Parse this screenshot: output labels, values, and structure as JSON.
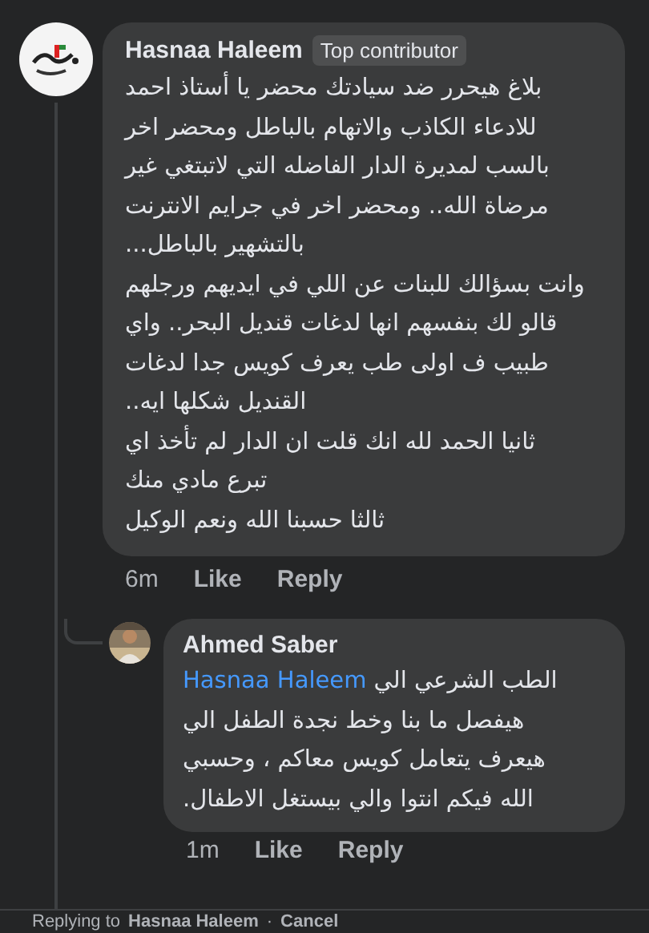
{
  "comment": {
    "author": "Hasnaa Haleem",
    "badge": "Top contributor",
    "text": "بلاغ هيحرر ضد سيادتك محضر يا أستاذ احمد\nللادعاء الكاذب والاتهام بالباطل ومحضر اخر\nبالسب لمديرة الدار الفاضله التي لاتبتغي غير\nمرضاة الله..  ومحضر اخر في جرايم الانترنت\nبالتشهير بالباطل...\nوانت بسؤالك للبنات عن اللي في ايديهم ورجلهم\nقالو لك بنفسهم انها لدغات قنديل البحر..  واي\nطبيب ف اولى طب يعرف كويس جدا لدغات\nالقنديل شكلها ايه..\nثانيا الحمد لله انك قلت ان الدار لم تأخذ اي\nتبرع مادي منك\nثالثا حسبنا الله ونعم الوكيل",
    "time": "6m",
    "like": "Like",
    "reply": "Reply"
  },
  "reply": {
    "author": "Ahmed Saber",
    "text_before": "الطب الشرعي الي",
    "mention": "Hasnaa Haleem",
    "text_after": "هيفصل ما بنا وخط نجدة الطفل الي\nهيعرف يتعامل كويس معاكم ، وحسبي\nالله فيكم انتوا والي بيستغل الاطفال.",
    "time": "1m",
    "like": "Like",
    "reply": "Reply"
  },
  "replying_bar": {
    "prefix": "Replying to",
    "name": "Hasnaa Haleem",
    "separator": "·",
    "cancel": "Cancel"
  }
}
